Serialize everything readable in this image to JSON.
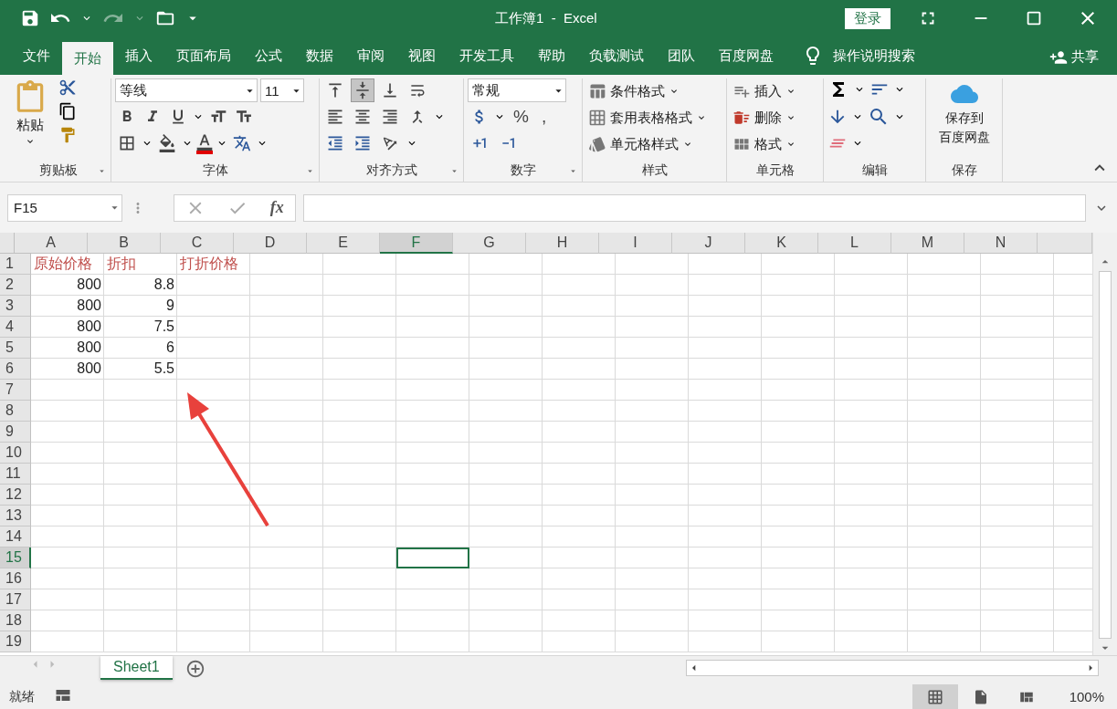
{
  "title_bar": {
    "title": "工作簿1  -  Excel",
    "sign_in": "登录"
  },
  "menu": {
    "tabs": [
      {
        "label": "文件",
        "selected": false
      },
      {
        "label": "开始",
        "selected": true
      },
      {
        "label": "插入",
        "selected": false
      },
      {
        "label": "页面布局",
        "selected": false
      },
      {
        "label": "公式",
        "selected": false
      },
      {
        "label": "数据",
        "selected": false
      },
      {
        "label": "审阅",
        "selected": false
      },
      {
        "label": "视图",
        "selected": false
      },
      {
        "label": "开发工具",
        "selected": false
      },
      {
        "label": "帮助",
        "selected": false
      },
      {
        "label": "负载测试",
        "selected": false
      },
      {
        "label": "团队",
        "selected": false
      },
      {
        "label": "百度网盘",
        "selected": false
      }
    ],
    "tell_me": "操作说明搜索",
    "share": "共享"
  },
  "ribbon": {
    "clipboard": {
      "paste": "粘贴",
      "label": "剪贴板"
    },
    "font": {
      "name": "等线",
      "size": "11",
      "label": "字体"
    },
    "alignment": {
      "vertical": [
        {
          "kind": "top",
          "selected": false
        },
        {
          "kind": "middle",
          "selected": true
        },
        {
          "kind": "bottom",
          "selected": false
        }
      ],
      "label": "对齐方式"
    },
    "number": {
      "format": "常规",
      "symbols": [
        "%",
        ","
      ],
      "label": "数字"
    },
    "styles": {
      "items": [
        "条件格式",
        "套用表格格式",
        "单元格样式"
      ],
      "label": "样式"
    },
    "cells": {
      "items": [
        "插入",
        "删除",
        "格式"
      ],
      "label": "单元格"
    },
    "editing": {
      "label": "编辑"
    },
    "save": {
      "button": [
        "保存到",
        "百度网盘"
      ],
      "label": "保存"
    }
  },
  "formula_bar": {
    "name_box": "F15",
    "fx": "fx"
  },
  "sheet": {
    "columns": [
      {
        "label": "A",
        "selected": false
      },
      {
        "label": "B",
        "selected": false
      },
      {
        "label": "C",
        "selected": false
      },
      {
        "label": "D",
        "selected": false
      },
      {
        "label": "E",
        "selected": false
      },
      {
        "label": "F",
        "selected": true
      },
      {
        "label": "G",
        "selected": false
      },
      {
        "label": "H",
        "selected": false
      },
      {
        "label": "I",
        "selected": false
      },
      {
        "label": "J",
        "selected": false
      },
      {
        "label": "K",
        "selected": false
      },
      {
        "label": "L",
        "selected": false
      },
      {
        "label": "M",
        "selected": false
      },
      {
        "label": "N",
        "selected": false
      }
    ],
    "rows": [
      {
        "number": "1",
        "selected": false,
        "cells": [
          {
            "value": "原始价格",
            "kind": "label"
          },
          {
            "value": "折扣",
            "kind": "label"
          },
          {
            "value": "打折价格",
            "kind": "label"
          }
        ]
      },
      {
        "number": "2",
        "selected": false,
        "cells": [
          {
            "value": "800",
            "kind": "number"
          },
          {
            "value": "8.8",
            "kind": "number"
          }
        ]
      },
      {
        "number": "3",
        "selected": false,
        "cells": [
          {
            "value": "800",
            "kind": "number"
          },
          {
            "value": "9",
            "kind": "number"
          }
        ]
      },
      {
        "number": "4",
        "selected": false,
        "cells": [
          {
            "value": "800",
            "kind": "number"
          },
          {
            "value": "7.5",
            "kind": "number"
          }
        ]
      },
      {
        "number": "5",
        "selected": false,
        "cells": [
          {
            "value": "800",
            "kind": "number"
          },
          {
            "value": "6",
            "kind": "number"
          }
        ]
      },
      {
        "number": "6",
        "selected": false,
        "cells": [
          {
            "value": "800",
            "kind": "number"
          },
          {
            "value": "5.5",
            "kind": "number"
          }
        ]
      },
      {
        "number": "7",
        "selected": false
      },
      {
        "number": "8",
        "selected": false
      },
      {
        "number": "9",
        "selected": false
      },
      {
        "number": "10",
        "selected": false
      },
      {
        "number": "11",
        "selected": false
      },
      {
        "number": "12",
        "selected": false
      },
      {
        "number": "13",
        "selected": false
      },
      {
        "number": "14",
        "selected": false
      },
      {
        "number": "15",
        "selected": true
      },
      {
        "number": "16",
        "selected": false
      },
      {
        "number": "17",
        "selected": false
      },
      {
        "number": "18",
        "selected": false
      },
      {
        "number": "19",
        "selected": false
      }
    ]
  },
  "sheet_tabs": [
    {
      "label": "Sheet1",
      "selected": true
    }
  ],
  "status_bar": {
    "status": "就绪",
    "views": [
      {
        "kind": "normal",
        "selected": true
      },
      {
        "kind": "page_layout",
        "selected": false
      },
      {
        "kind": "page_break",
        "selected": false
      }
    ],
    "zoom": "100%"
  }
}
